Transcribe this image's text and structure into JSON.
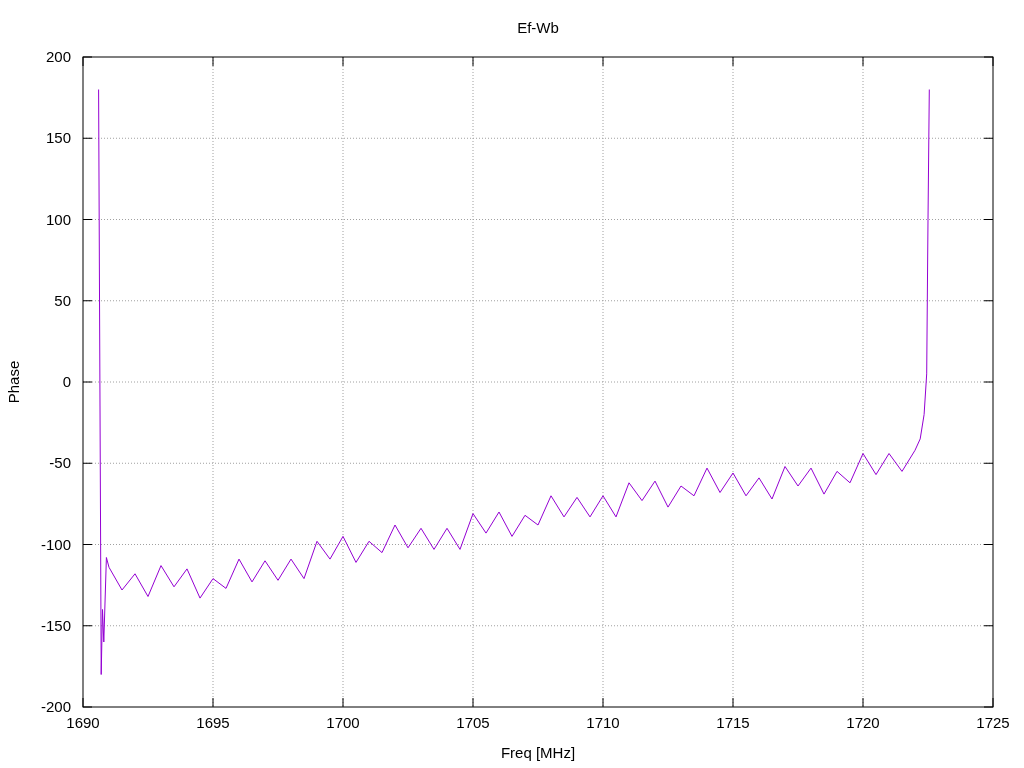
{
  "chart_data": {
    "type": "line",
    "grid": true,
    "title": "Ef-Wb",
    "xlabel": "Freq [MHz]",
    "ylabel": "Phase",
    "xlim": [
      1690,
      1725
    ],
    "ylim": [
      -200,
      200
    ],
    "xticks": [
      1690,
      1695,
      1700,
      1705,
      1710,
      1715,
      1720,
      1725
    ],
    "yticks": [
      -200,
      -150,
      -100,
      -50,
      0,
      50,
      100,
      150,
      200
    ],
    "x": [
      1690.6,
      1690.65,
      1690.7,
      1690.75,
      1690.8,
      1690.9,
      1691,
      1691.5,
      1692,
      1692.5,
      1693,
      1693.5,
      1694,
      1694.5,
      1695,
      1695.5,
      1696,
      1696.5,
      1697,
      1697.5,
      1698,
      1698.5,
      1699,
      1699.5,
      1700,
      1700.5,
      1701,
      1701.5,
      1702,
      1702.5,
      1703,
      1703.5,
      1704,
      1704.5,
      1705,
      1705.5,
      1706,
      1706.5,
      1707,
      1707.5,
      1708,
      1708.5,
      1709,
      1709.5,
      1710,
      1710.5,
      1711,
      1711.5,
      1712,
      1712.5,
      1713,
      1713.5,
      1714,
      1714.5,
      1715,
      1715.5,
      1716,
      1716.5,
      1717,
      1717.5,
      1718,
      1718.5,
      1719,
      1719.5,
      1720,
      1720.5,
      1721,
      1721.5,
      1722,
      1722.2,
      1722.35,
      1722.45,
      1722.5,
      1722.55
    ],
    "series": [
      {
        "color": "#9400d3",
        "values": [
          180,
          0,
          -180,
          -140,
          -160,
          -108,
          -114,
          -128,
          -118,
          -132,
          -113,
          -126,
          -115,
          -133,
          -121,
          -127,
          -109,
          -123,
          -110,
          -122,
          -109,
          -121,
          -98,
          -109,
          -95,
          -111,
          -98,
          -105,
          -88,
          -102,
          -90,
          -103,
          -90,
          -103,
          -81,
          -93,
          -80,
          -95,
          -82,
          -88,
          -70,
          -83,
          -71,
          -83,
          -70,
          -83,
          -62,
          -73,
          -61,
          -77,
          -64,
          -70,
          -53,
          -68,
          -56,
          -70,
          -59,
          -72,
          -52,
          -64,
          -53,
          -69,
          -55,
          -62,
          -44,
          -57,
          -44,
          -55,
          -42,
          -35,
          -20,
          5,
          100,
          180
        ]
      }
    ]
  }
}
